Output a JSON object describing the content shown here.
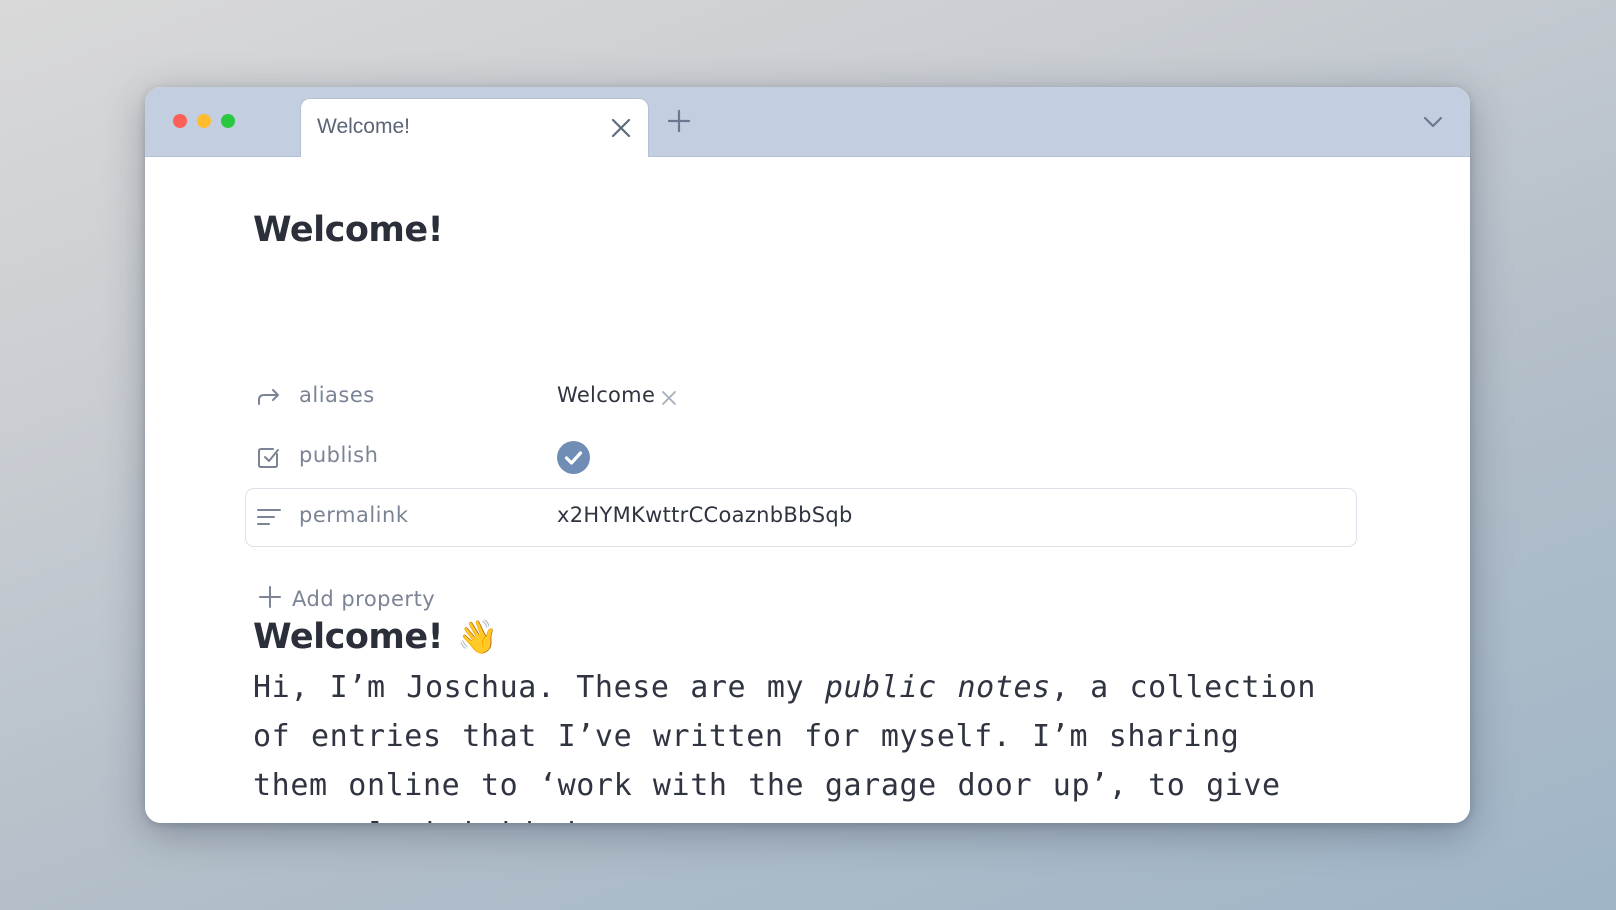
{
  "window": {
    "traffic_lights": [
      {
        "name": "close",
        "color": "#fe5f57"
      },
      {
        "name": "minimize",
        "color": "#febc2e"
      },
      {
        "name": "maximize",
        "color": "#28c840"
      }
    ]
  },
  "tabs": [
    {
      "label": "Welcome!",
      "active": true,
      "close_icon": "close-icon"
    }
  ],
  "tabbar": {
    "new_tab_icon": "plus-icon",
    "menu_icon": "chevron-down-icon"
  },
  "note": {
    "title": "Welcome!",
    "properties": [
      {
        "icon": "arrow-forward-icon",
        "label": "aliases",
        "type": "list",
        "values": [
          "Welcome"
        ]
      },
      {
        "icon": "checkbox-icon",
        "label": "publish",
        "type": "checkbox",
        "checked": true
      },
      {
        "icon": "text-lines-icon",
        "label": "permalink",
        "type": "text",
        "value": "x2HYMKwttrCCoaznbBbSqb",
        "focused": true
      }
    ],
    "add_property_label": "Add property",
    "body": {
      "heading": "Welcome!",
      "heading_emoji": "👋",
      "paragraph_parts": [
        {
          "text": "Hi, I’m Joschua. These are my ",
          "style": "normal"
        },
        {
          "text": "public notes",
          "style": "italic"
        },
        {
          "text": ", a collection of entries that I’ve written for myself. I’m sharing them online to ‘work with the garage door up’, to give you a look behind",
          "style": "normal"
        }
      ]
    }
  },
  "colors": {
    "tabbar_bg": "#c3cfe0",
    "accent": "#6f8db5",
    "text_primary": "#2a2f3a",
    "text_muted": "#7b8494"
  }
}
